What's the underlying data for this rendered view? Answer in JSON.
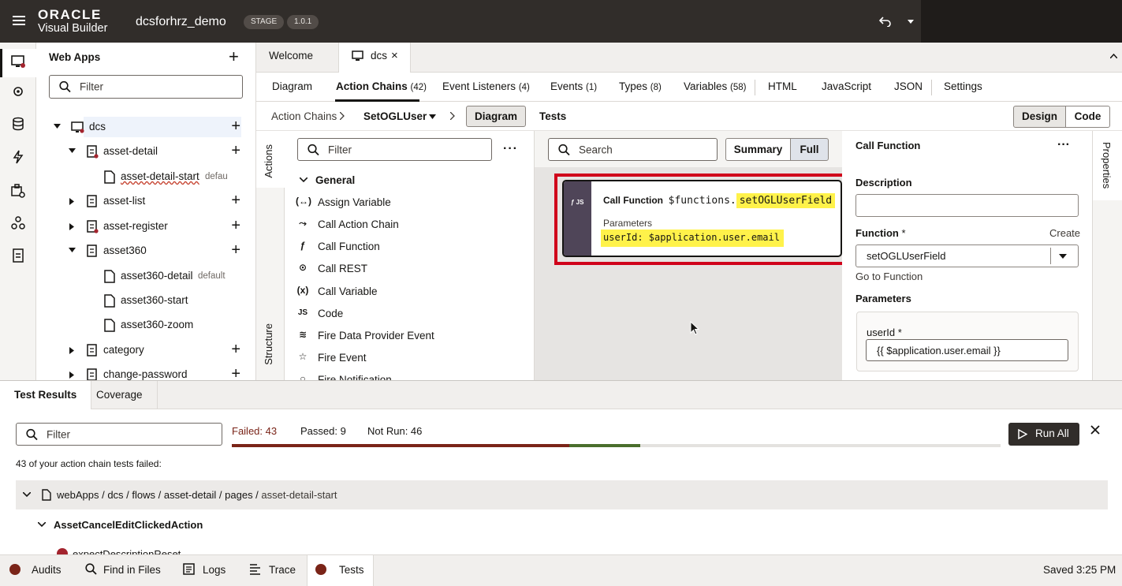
{
  "header": {
    "brand_line1": "ORACLE",
    "brand_line2": "Visual Builder",
    "app_name": "dcsforhrz_demo",
    "stage_badge": "STAGE",
    "version_badge": "1.0.1"
  },
  "nav": {
    "title": "Web Apps",
    "filter_placeholder": "Filter",
    "tree": [
      {
        "label": "dcs"
      },
      {
        "label": "asset-detail"
      },
      {
        "label": "asset-detail-start",
        "badge": "defau"
      },
      {
        "label": "asset-list"
      },
      {
        "label": "asset-register"
      },
      {
        "label": "asset360"
      },
      {
        "label": "asset360-detail",
        "badge": "default"
      },
      {
        "label": "asset360-start"
      },
      {
        "label": "asset360-zoom"
      },
      {
        "label": "category"
      },
      {
        "label": "change-password"
      }
    ]
  },
  "doc_tabs": {
    "welcome": "Welcome",
    "dcs": "dcs"
  },
  "subnav": {
    "diagram": "Diagram",
    "action_chains": "Action Chains",
    "action_chains_count": "(42)",
    "event_listeners": "Event Listeners",
    "event_listeners_count": "(4)",
    "events": "Events",
    "events_count": "(1)",
    "types": "Types",
    "types_count": "(8)",
    "variables": "Variables",
    "variables_count": "(58)",
    "html": "HTML",
    "javascript": "JavaScript",
    "json": "JSON",
    "settings": "Settings"
  },
  "crumb": {
    "action_chains": "Action Chains",
    "chain": "SetOGLUser",
    "diagram": "Diagram",
    "tests": "Tests",
    "design": "Design",
    "code": "Code"
  },
  "side_tabs": {
    "actions": "Actions",
    "structure": "Structure",
    "properties": "Properties"
  },
  "actions": {
    "filter_placeholder": "Filter",
    "group": "General",
    "items": [
      {
        "icon": "(↔)",
        "label": "Assign Variable"
      },
      {
        "icon": "⤳",
        "label": "Call Action Chain"
      },
      {
        "icon": "ƒ",
        "label": "Call Function"
      },
      {
        "icon": "⊙",
        "label": "Call REST"
      },
      {
        "icon": "(x)",
        "label": "Call Variable"
      },
      {
        "icon": "JS",
        "label": "Code"
      },
      {
        "icon": "≋",
        "label": "Fire Data Provider Event"
      },
      {
        "icon": "☆",
        "label": "Fire Event"
      },
      {
        "icon": "○",
        "label": "Fire Notification"
      }
    ]
  },
  "canvas": {
    "search_placeholder": "Search",
    "summary": "Summary",
    "full": "Full",
    "node": {
      "title": "Call Function",
      "func_prefix": "$functions.",
      "func_name": "setOGLUserField",
      "params_label": "Parameters",
      "param_line": "userId: $application.user.email"
    }
  },
  "properties": {
    "title": "Call Function",
    "description_label": "Description",
    "description_value": "",
    "function_label": "Function",
    "required_mark": "*",
    "create_link": "Create",
    "function_value": "setOGLUserField",
    "goto_link": "Go to Function",
    "parameters_label": "Parameters",
    "param_name": "userId",
    "param_value": "{{ $application.user.email }}"
  },
  "bottom_tabs": {
    "test_results": "Test Results",
    "coverage": "Coverage"
  },
  "results": {
    "filter_placeholder": "Filter",
    "failed": "Failed: 43",
    "passed": "Passed: 9",
    "not_run": "Not Run: 46",
    "run_all": "Run All",
    "summary": "43 of your action chain tests failed:",
    "path": "webApps / dcs / flows / asset-detail / pages /",
    "path_last": "asset-detail-start",
    "action_name": "AssetCancelEditClickedAction",
    "test_name": "expectDescriptionReset",
    "progress": {
      "failed": 43,
      "passed": 9,
      "not_run": 46
    }
  },
  "statusbar": {
    "audits": "Audits",
    "find": "Find in Files",
    "logs": "Logs",
    "trace": "Trace",
    "tests": "Tests",
    "saved": "Saved 3:25 PM"
  },
  "colors": {
    "header_bg": "#312d2a",
    "failed_red": "#7a2418",
    "passed_green": "#4a6e2c",
    "highlight_yellow": "#fff24a",
    "selection_red": "#d0021b",
    "node_side": "#4f4558"
  }
}
